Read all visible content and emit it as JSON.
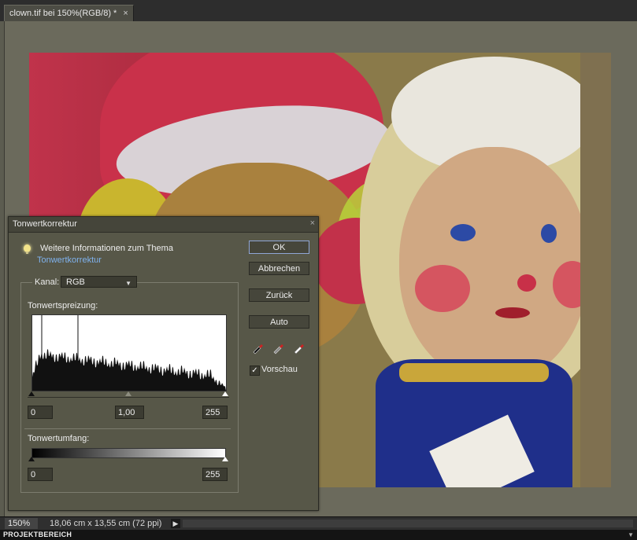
{
  "tab": {
    "title": "clown.tif bei 150%(RGB/8) *",
    "close": "×"
  },
  "statusbar": {
    "zoom": "150%",
    "docinfo": "18,06 cm x 13,55 cm (72 ppi)",
    "arrow": "▶"
  },
  "projectbar": {
    "label": "PROJEKTBEREICH",
    "arrow": "▼"
  },
  "dialog": {
    "title": "Tonwertkorrektur",
    "close": "×",
    "info_text": "Weitere Informationen zum Thema",
    "info_link": "Tonwertkorrektur",
    "channel_label": "Kanal:",
    "channel_value": "RGB",
    "input_levels_label": "Tonwertspreizung:",
    "input_black": "0",
    "input_gamma": "1,00",
    "input_white": "255",
    "output_levels_label": "Tonwertumfang:",
    "output_black": "0",
    "output_white": "255",
    "buttons": {
      "ok": "OK",
      "cancel": "Abbrechen",
      "reset": "Zurück",
      "auto": "Auto"
    },
    "preview_label": "Vorschau",
    "preview_checked": true
  },
  "colors": {
    "accent_link": "#7fb2ee",
    "dialog_bg": "#575748"
  }
}
